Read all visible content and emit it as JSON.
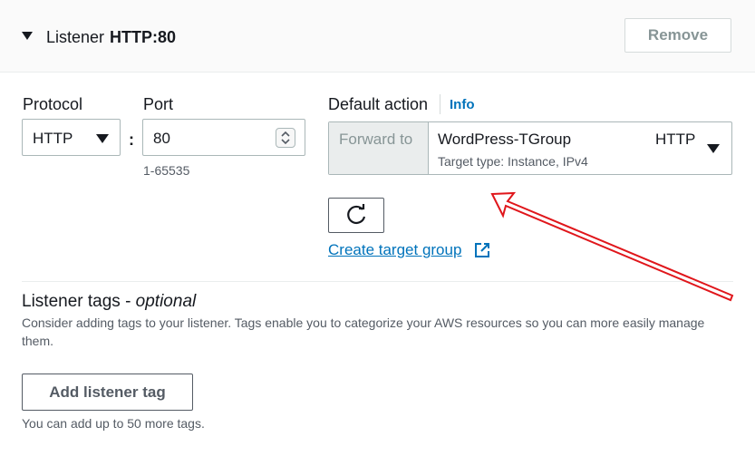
{
  "header": {
    "title": "Listener",
    "listener_name": "HTTP:80",
    "remove_label": "Remove"
  },
  "protocol": {
    "label": "Protocol",
    "value": "HTTP"
  },
  "port": {
    "label": "Port",
    "value": "80",
    "hint": "1-65535"
  },
  "default_action": {
    "label": "Default action",
    "info_label": "Info",
    "forward_label": "Forward to",
    "target_group": "WordPress-TGroup",
    "target_protocol": "HTTP",
    "target_type": "Target type: Instance, IPv4",
    "create_link": "Create target group"
  },
  "tags": {
    "title": "Listener tags - ",
    "title_optional": "optional",
    "description": "Consider adding tags to your listener. Tags enable you to categorize your AWS resources so you can more easily manage them.",
    "add_label": "Add listener tag",
    "footer": "You can add up to 50 more tags."
  },
  "colors": {
    "link": "#0073bb",
    "annotation_arrow": "#e0161b"
  }
}
